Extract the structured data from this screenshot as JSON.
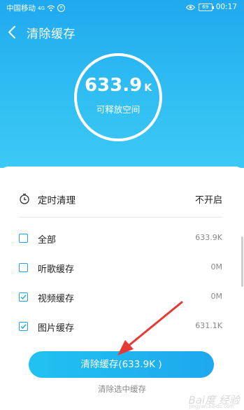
{
  "status_bar": {
    "carrier": "中国移动",
    "signal": "4G",
    "battery": "69",
    "time": "00:17"
  },
  "header": {
    "title": "清除缓存"
  },
  "summary": {
    "value": "633.9",
    "unit": "K",
    "caption": "可释放空间"
  },
  "timer": {
    "label": "定时清理",
    "value": "不开启"
  },
  "items": [
    {
      "label": "全部",
      "size": "633.9K",
      "checked": false
    },
    {
      "label": "听歌缓存",
      "size": "0M",
      "checked": false
    },
    {
      "label": "视频缓存",
      "size": "0M",
      "checked": true
    },
    {
      "label": "图片缓存",
      "size": "631.1K",
      "checked": true
    }
  ],
  "actions": {
    "clean_button": "清除缓存(633.9K )",
    "clean_selected": "清除选中缓存"
  },
  "watermark": {
    "logo": "Bai度 经验",
    "url": "jingyan.baidu.com"
  },
  "colors": {
    "accent": "#1ea8ee",
    "annotation_arrow": "#e53935"
  }
}
